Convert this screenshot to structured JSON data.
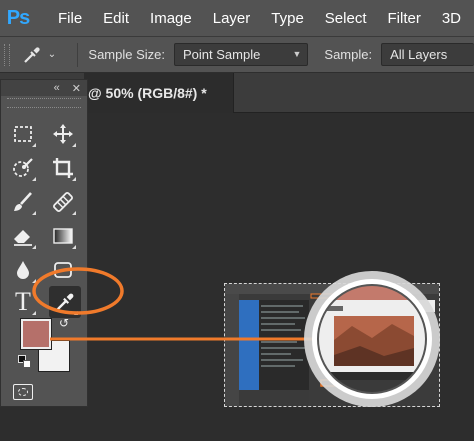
{
  "app": {
    "logo": "Ps"
  },
  "menu": [
    "File",
    "Edit",
    "Image",
    "Layer",
    "Type",
    "Select",
    "Filter",
    "3D"
  ],
  "options": {
    "tool_icon": "eyedropper-icon",
    "sample_size_label": "Sample Size:",
    "sample_size_value": "Point Sample",
    "sample_label": "Sample:",
    "sample_value": "All Layers"
  },
  "document": {
    "tab_title": "@ 50% (RGB/8#) *"
  },
  "tools_panel": {
    "collapse_glyph": "«",
    "close_glyph": "✕",
    "type_glyph": "T",
    "tools": [
      "marquee-icon",
      "move-icon",
      "quick-selection-icon",
      "crop-icon",
      "brush-icon",
      "stamp-icon",
      "eraser-icon",
      "gradient-icon",
      "blur-icon",
      "shape-icon",
      "type-icon",
      "eyedropper-icon"
    ]
  },
  "colors": {
    "foreground": "#b5706a",
    "background": "#f2f2f2",
    "callout": "#f07a2b",
    "panel": "#535353",
    "canvas": "#2d2d2d",
    "accent": "#31a8ff"
  }
}
